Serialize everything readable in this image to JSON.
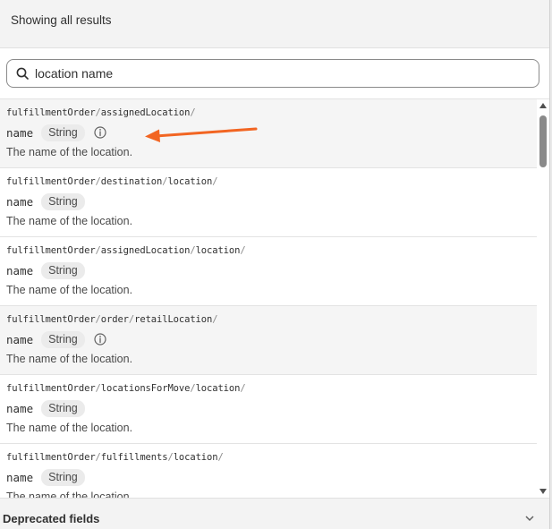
{
  "header": {
    "title": "Showing all results"
  },
  "search": {
    "value": "location name",
    "icon": "search-icon"
  },
  "results": [
    {
      "path": [
        "fulfillmentOrder",
        "assignedLocation"
      ],
      "name": "name",
      "type": "String",
      "info": true,
      "description": "The name of the location.",
      "highlight": true
    },
    {
      "path": [
        "fulfillmentOrder",
        "destination",
        "location"
      ],
      "name": "name",
      "type": "String",
      "info": false,
      "description": "The name of the location.",
      "highlight": false
    },
    {
      "path": [
        "fulfillmentOrder",
        "assignedLocation",
        "location"
      ],
      "name": "name",
      "type": "String",
      "info": false,
      "description": "The name of the location.",
      "highlight": false
    },
    {
      "path": [
        "fulfillmentOrder",
        "order",
        "retailLocation"
      ],
      "name": "name",
      "type": "String",
      "info": true,
      "description": "The name of the location.",
      "highlight": true
    },
    {
      "path": [
        "fulfillmentOrder",
        "locationsForMove",
        "location"
      ],
      "name": "name",
      "type": "String",
      "info": false,
      "description": "The name of the location.",
      "highlight": false
    },
    {
      "path": [
        "fulfillmentOrder",
        "fulfillments",
        "location"
      ],
      "name": "name",
      "type": "String",
      "info": false,
      "description": "The name of the location.",
      "highlight": false
    }
  ],
  "footer": {
    "title": "Deprecated fields",
    "icon": "chevron-down-icon"
  },
  "colors": {
    "arrow": "#f26522",
    "badge_bg": "#ebebeb",
    "row_highlight": "#f5f5f5"
  }
}
